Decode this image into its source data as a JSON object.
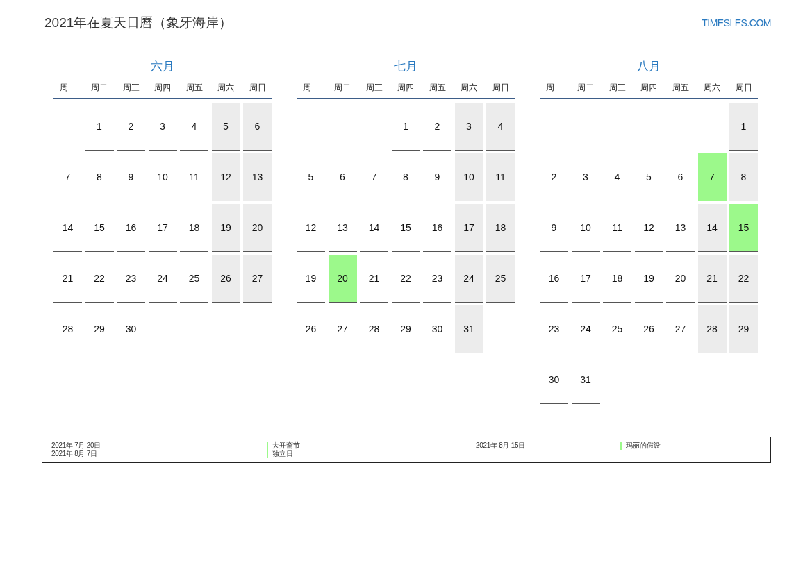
{
  "title": "2021年在夏天日曆（象牙海岸）",
  "site": "TIMESLES.COM",
  "months": [
    {
      "name": "六月",
      "weekdays": [
        "周一",
        "周二",
        "周三",
        "周四",
        "周五",
        "周六",
        "周日"
      ],
      "weeks": [
        {
          "right_aligned": true,
          "days": [
            {
              "day": "1",
              "kind": "weekday"
            },
            {
              "day": "2",
              "kind": "weekday"
            },
            {
              "day": "3",
              "kind": "weekday"
            },
            {
              "day": "4",
              "kind": "weekday"
            },
            {
              "day": "5",
              "kind": "weekend"
            },
            {
              "day": "6",
              "kind": "weekend"
            }
          ]
        },
        {
          "days": [
            {
              "day": "7",
              "kind": "weekday"
            },
            {
              "day": "8",
              "kind": "weekday"
            },
            {
              "day": "9",
              "kind": "weekday"
            },
            {
              "day": "10",
              "kind": "weekday"
            },
            {
              "day": "11",
              "kind": "weekday"
            },
            {
              "day": "12",
              "kind": "weekend"
            },
            {
              "day": "13",
              "kind": "weekend"
            }
          ]
        },
        {
          "days": [
            {
              "day": "14",
              "kind": "weekday"
            },
            {
              "day": "15",
              "kind": "weekday"
            },
            {
              "day": "16",
              "kind": "weekday"
            },
            {
              "day": "17",
              "kind": "weekday"
            },
            {
              "day": "18",
              "kind": "weekday"
            },
            {
              "day": "19",
              "kind": "weekend"
            },
            {
              "day": "20",
              "kind": "weekend"
            }
          ]
        },
        {
          "days": [
            {
              "day": "21",
              "kind": "weekday"
            },
            {
              "day": "22",
              "kind": "weekday"
            },
            {
              "day": "23",
              "kind": "weekday"
            },
            {
              "day": "24",
              "kind": "weekday"
            },
            {
              "day": "25",
              "kind": "weekday"
            },
            {
              "day": "26",
              "kind": "weekend"
            },
            {
              "day": "27",
              "kind": "weekend"
            }
          ]
        },
        {
          "right_aligned": false,
          "days": [
            {
              "day": "28",
              "kind": "weekday"
            },
            {
              "day": "29",
              "kind": "weekday"
            },
            {
              "day": "30",
              "kind": "weekday"
            }
          ]
        }
      ]
    },
    {
      "name": "七月",
      "weekdays": [
        "周一",
        "周二",
        "周三",
        "周四",
        "周五",
        "周六",
        "周日"
      ],
      "weeks": [
        {
          "right_aligned": true,
          "days": [
            {
              "day": "1",
              "kind": "weekday"
            },
            {
              "day": "2",
              "kind": "weekday"
            },
            {
              "day": "3",
              "kind": "weekend"
            },
            {
              "day": "4",
              "kind": "weekend"
            }
          ]
        },
        {
          "days": [
            {
              "day": "5",
              "kind": "weekday"
            },
            {
              "day": "6",
              "kind": "weekday"
            },
            {
              "day": "7",
              "kind": "weekday"
            },
            {
              "day": "8",
              "kind": "weekday"
            },
            {
              "day": "9",
              "kind": "weekday"
            },
            {
              "day": "10",
              "kind": "weekend"
            },
            {
              "day": "11",
              "kind": "weekend"
            }
          ]
        },
        {
          "days": [
            {
              "day": "12",
              "kind": "weekday"
            },
            {
              "day": "13",
              "kind": "weekday"
            },
            {
              "day": "14",
              "kind": "weekday"
            },
            {
              "day": "15",
              "kind": "weekday"
            },
            {
              "day": "16",
              "kind": "weekday"
            },
            {
              "day": "17",
              "kind": "weekend"
            },
            {
              "day": "18",
              "kind": "weekend"
            }
          ]
        },
        {
          "days": [
            {
              "day": "19",
              "kind": "weekday"
            },
            {
              "day": "20",
              "kind": "holiday"
            },
            {
              "day": "21",
              "kind": "weekday"
            },
            {
              "day": "22",
              "kind": "weekday"
            },
            {
              "day": "23",
              "kind": "weekday"
            },
            {
              "day": "24",
              "kind": "weekend"
            },
            {
              "day": "25",
              "kind": "weekend"
            }
          ]
        },
        {
          "right_aligned": false,
          "days": [
            {
              "day": "26",
              "kind": "weekday"
            },
            {
              "day": "27",
              "kind": "weekday"
            },
            {
              "day": "28",
              "kind": "weekday"
            },
            {
              "day": "29",
              "kind": "weekday"
            },
            {
              "day": "30",
              "kind": "weekday"
            },
            {
              "day": "31",
              "kind": "weekend"
            }
          ]
        }
      ]
    },
    {
      "name": "八月",
      "weekdays": [
        "周一",
        "周二",
        "周三",
        "周四",
        "周五",
        "周六",
        "周日"
      ],
      "weeks": [
        {
          "right_aligned": true,
          "days": [
            {
              "day": "1",
              "kind": "weekend"
            }
          ]
        },
        {
          "days": [
            {
              "day": "2",
              "kind": "weekday"
            },
            {
              "day": "3",
              "kind": "weekday"
            },
            {
              "day": "4",
              "kind": "weekday"
            },
            {
              "day": "5",
              "kind": "weekday"
            },
            {
              "day": "6",
              "kind": "weekday"
            },
            {
              "day": "7",
              "kind": "holiday"
            },
            {
              "day": "8",
              "kind": "weekend"
            }
          ]
        },
        {
          "days": [
            {
              "day": "9",
              "kind": "weekday"
            },
            {
              "day": "10",
              "kind": "weekday"
            },
            {
              "day": "11",
              "kind": "weekday"
            },
            {
              "day": "12",
              "kind": "weekday"
            },
            {
              "day": "13",
              "kind": "weekday"
            },
            {
              "day": "14",
              "kind": "weekend"
            },
            {
              "day": "15",
              "kind": "holiday"
            }
          ]
        },
        {
          "days": [
            {
              "day": "16",
              "kind": "weekday"
            },
            {
              "day": "17",
              "kind": "weekday"
            },
            {
              "day": "18",
              "kind": "weekday"
            },
            {
              "day": "19",
              "kind": "weekday"
            },
            {
              "day": "20",
              "kind": "weekday"
            },
            {
              "day": "21",
              "kind": "weekend"
            },
            {
              "day": "22",
              "kind": "weekend"
            }
          ]
        },
        {
          "days": [
            {
              "day": "23",
              "kind": "weekday"
            },
            {
              "day": "24",
              "kind": "weekday"
            },
            {
              "day": "25",
              "kind": "weekday"
            },
            {
              "day": "26",
              "kind": "weekday"
            },
            {
              "day": "27",
              "kind": "weekday"
            },
            {
              "day": "28",
              "kind": "weekend"
            },
            {
              "day": "29",
              "kind": "weekend"
            }
          ]
        },
        {
          "right_aligned": false,
          "days": [
            {
              "day": "30",
              "kind": "weekday"
            },
            {
              "day": "31",
              "kind": "weekday"
            }
          ]
        }
      ]
    }
  ],
  "holidays": [
    {
      "date": "2021年 7月 20日",
      "name": "大开斋节"
    },
    {
      "date": "2021年 8月 7日",
      "name": "独立日"
    },
    {
      "date": "2021年 8月 15日",
      "name": "玛丽的假设"
    }
  ]
}
